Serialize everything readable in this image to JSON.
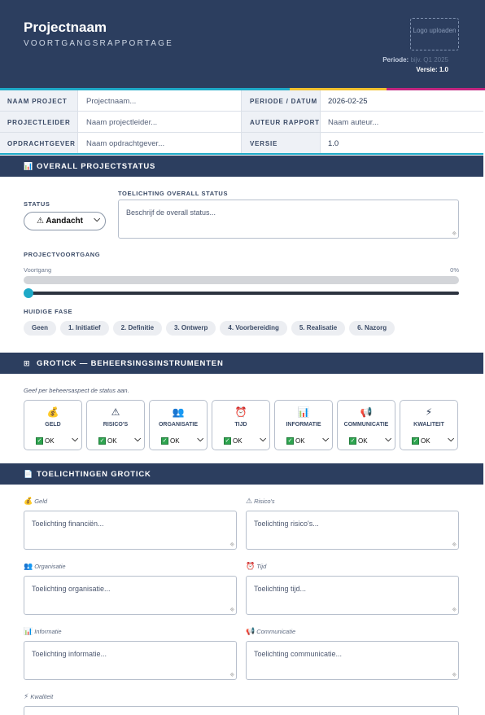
{
  "header": {
    "title": "Projectnaam",
    "subtitle": "VOORTGANGSRAPPORTAGE",
    "logo_placeholder": "Logo uploaden",
    "period_label": "Periode:",
    "period_placeholder": "bijv. Q1 2025",
    "version_text": "Versie: 1.0"
  },
  "stripe_colors": [
    "#1ea9c7",
    "#f2c12e",
    "#c2257f"
  ],
  "info_table": [
    {
      "label": "NAAM PROJECT",
      "value": "Projectnaam...",
      "label2": "PERIODE / DATUM",
      "value2": "2026-02-25"
    },
    {
      "label": "PROJECTLEIDER",
      "value": "Naam projectleider...",
      "label2": "AUTEUR RAPPORT",
      "value2": "Naam auteur..."
    },
    {
      "label": "OPDRACHTGEVER",
      "value": "Naam opdrachtgever...",
      "label2": "VERSIE",
      "value2": "1.0"
    }
  ],
  "overall": {
    "section_title": "OVERALL PROJECTSTATUS",
    "section_icon": "bar-chart-icon",
    "status_label": "STATUS",
    "status_value": "Aandacht",
    "status_icon": "warning-icon",
    "explanation_label": "TOELICHTING OVERALL STATUS",
    "explanation_placeholder": "Beschrijf de overall status...",
    "progress_section_label": "PROJECTVOORTGANG",
    "progress_label": "Voortgang",
    "progress_text": "0%",
    "progress_value": 0,
    "phase_label": "HUIDIGE FASE",
    "phases": [
      "Geen",
      "1. Initiatief",
      "2. Definitie",
      "3. Ontwerp",
      "4. Voorbereiding",
      "5. Realisatie",
      "6. Nazorg"
    ]
  },
  "grotick": {
    "section_title": "GROTICK — BEHEERSINGSINSTRUMENTEN",
    "section_icon": "grid-icon",
    "hint": "Geef per beheersaspect de status aan.",
    "items": [
      {
        "icon": "💰",
        "icon_name": "money-bag-icon",
        "name": "GELD",
        "status": "OK"
      },
      {
        "icon": "⚠",
        "icon_name": "warning-icon",
        "name": "RISICO'S",
        "status": "OK"
      },
      {
        "icon": "👥",
        "icon_name": "people-icon",
        "name": "ORGANISATIE",
        "status": "OK"
      },
      {
        "icon": "⏰",
        "icon_name": "alarm-clock-icon",
        "name": "TIJD",
        "status": "OK"
      },
      {
        "icon": "📊",
        "icon_name": "bar-chart-icon",
        "name": "INFORMATIE",
        "status": "OK"
      },
      {
        "icon": "📢",
        "icon_name": "megaphone-icon",
        "name": "COMMUNICATIE",
        "status": "OK"
      },
      {
        "icon": "⚡",
        "icon_name": "sparkle-icon",
        "name": "KWALITEIT",
        "status": "OK"
      }
    ]
  },
  "explanations": {
    "section_title": "TOELICHTINGEN GROTICK",
    "section_icon": "document-icon",
    "fields": [
      {
        "label": "Geld",
        "icon": "💰",
        "icon_name": "money-bag-icon",
        "placeholder": "Toelichting financiën..."
      },
      {
        "label": "Risico's",
        "icon": "⚠",
        "icon_name": "warning-icon",
        "placeholder": "Toelichting risico's..."
      },
      {
        "label": "Organisatie",
        "icon": "👥",
        "icon_name": "people-icon",
        "placeholder": "Toelichting organisatie..."
      },
      {
        "label": "Tijd",
        "icon": "⏰",
        "icon_name": "alarm-clock-icon",
        "placeholder": "Toelichting tijd..."
      },
      {
        "label": "Informatie",
        "icon": "📊",
        "icon_name": "bar-chart-icon",
        "placeholder": "Toelichting informatie..."
      },
      {
        "label": "Communicatie",
        "icon": "📢",
        "icon_name": "megaphone-icon",
        "placeholder": "Toelichting communicatie..."
      },
      {
        "label": "Kwaliteit",
        "icon": "⚡",
        "icon_name": "sparkle-icon",
        "placeholder": ""
      }
    ]
  }
}
